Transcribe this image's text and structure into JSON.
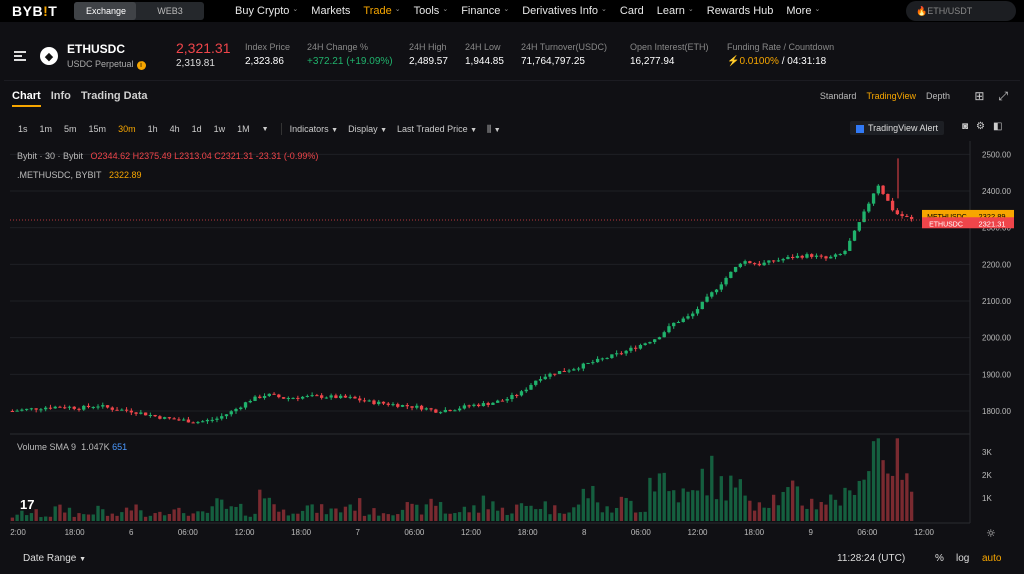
{
  "nav": {
    "logo_a": "BYB",
    "logo_i": "!",
    "logo_b": "T",
    "seg": [
      "Exchange",
      "WEB3"
    ],
    "items": [
      {
        "label": "Buy Crypto",
        "chev": true
      },
      {
        "label": "Markets",
        "chev": false
      },
      {
        "label": "Trade",
        "chev": true,
        "active": true
      },
      {
        "label": "Tools",
        "chev": true
      },
      {
        "label": "Finance",
        "chev": true
      },
      {
        "label": "Derivatives Info",
        "chev": true
      },
      {
        "label": "Card",
        "chev": false
      },
      {
        "label": "Learn",
        "chev": true
      },
      {
        "label": "Rewards Hub",
        "chev": false
      },
      {
        "label": "More",
        "chev": true
      }
    ],
    "search_placeholder": "🔥ETH/USDT"
  },
  "ticker": {
    "symbol": "ETHUSDC",
    "product": "USDC Perpetual",
    "last_price": "2,321.31",
    "mark_price": "2,319.81",
    "stats": [
      {
        "label": "Index Price",
        "value": "2,323.86"
      },
      {
        "label": "24H Change %",
        "value": "+372.21 (+19.09%)"
      },
      {
        "label": "24H High",
        "value": "2,489.57"
      },
      {
        "label": "24H Low",
        "value": "1,944.85"
      },
      {
        "label": "24H Turnover(USDC)",
        "value": "71,764,797.25"
      },
      {
        "label": "Open Interest(ETH)",
        "value": "16,277.94"
      },
      {
        "label": "Funding Rate / Countdown",
        "value_a": "0.0100%",
        "value_b": " / 04:31:18"
      }
    ]
  },
  "panel": {
    "tabs": [
      "Chart",
      "Info",
      "Trading Data"
    ],
    "views": [
      "Standard",
      "TradingView",
      "Depth"
    ],
    "timeframes": [
      "1s",
      "1m",
      "5m",
      "15m",
      "30m",
      "1h",
      "4h",
      "1d",
      "1w",
      "1M"
    ],
    "active_tf": "30m",
    "dropdowns": [
      "Indicators",
      "Display",
      "Last Traded Price"
    ],
    "tv_alert": "TradingView Alert"
  },
  "legend": {
    "source": "Bybit · 30 · Bybit",
    "o": "O2344.62",
    "h": "H2375.49",
    "l": "L2313.04",
    "c": "C2321.31",
    "chg": "-23.31 (-0.99%)",
    "index_name": ".METHUSDC, BYBIT",
    "index_val": "2322.89",
    "vol_name": "Volume SMA 9",
    "vol_a": "1.047K",
    "vol_b": "651"
  },
  "footer": {
    "date_range": "Date Range",
    "clock": "11:28:24 (UTC)",
    "pct": "%",
    "log": "log",
    "auto": "auto"
  },
  "chart_data": {
    "type": "candlestick",
    "y_ticks": [
      1800,
      1900,
      2000,
      2100,
      2200,
      2300,
      2400,
      2500
    ],
    "y_tick_labels": [
      "1800.00",
      "1900.00",
      "2000.00",
      "2100.00",
      "2200.00",
      "2300.00",
      "2400.00",
      "2500.00"
    ],
    "x_tick_labels": [
      "2:00",
      "18:00",
      "6",
      "06:00",
      "12:00",
      "18:00",
      "7",
      "06:00",
      "12:00",
      "18:00",
      "8",
      "06:00",
      "12:00",
      "18:00",
      "9",
      "06:00",
      "12:00"
    ],
    "price_path": [
      1800,
      1805,
      1810,
      1812,
      1808,
      1815,
      1805,
      1800,
      1790,
      1780,
      1775,
      1770,
      1778,
      1800,
      1830,
      1845,
      1835,
      1838,
      1840,
      1838,
      1835,
      1825,
      1820,
      1815,
      1810,
      1800,
      1805,
      1815,
      1820,
      1830,
      1850,
      1890,
      1905,
      1915,
      1930,
      1945,
      1960,
      1980,
      2000,
      2040,
      2060,
      2110,
      2160,
      2210,
      2200,
      2210,
      2220,
      2225,
      2215,
      2230,
      2320,
      2420,
      2340,
      2322
    ],
    "volume_path": [
      200,
      350,
      250,
      500,
      300,
      450,
      260,
      600,
      350,
      500,
      400,
      300,
      700,
      500,
      350,
      1100,
      400,
      600,
      500,
      450,
      700,
      380,
      420,
      600,
      500,
      800,
      380,
      500,
      900,
      450,
      600,
      700,
      500,
      600,
      1200,
      450,
      800,
      600,
      1900,
      1300,
      1100,
      2000,
      1500,
      1300,
      900,
      1000,
      1200,
      800,
      900,
      1000,
      2200,
      3500,
      2900,
      1500
    ],
    "volume_ticks": [
      "1K",
      "2K",
      "3K"
    ],
    "last_labels": [
      {
        "name": ".METHUSDC",
        "value": "2322.89"
      },
      {
        "name": "ETHUSDC",
        "value": "2321.31"
      }
    ]
  }
}
